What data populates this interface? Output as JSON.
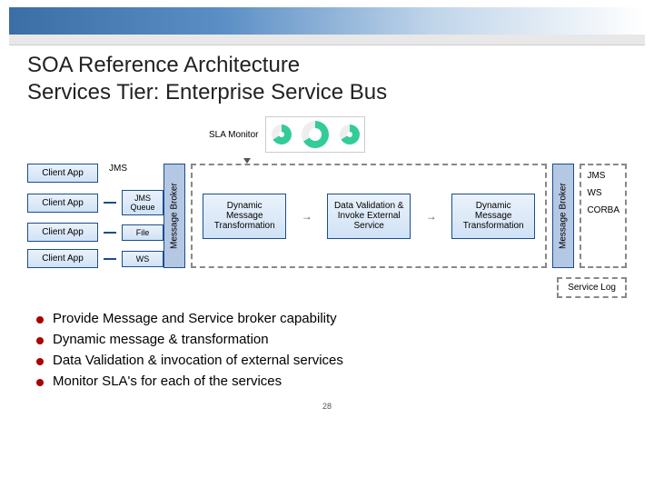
{
  "title_line1": "SOA Reference Architecture",
  "title_line2": "Services Tier: Enterprise Service Bus",
  "sla_label": "SLA Monitor",
  "clients": {
    "c1": "Client App",
    "c2": "Client App",
    "c3": "Client App",
    "c4": "Client App"
  },
  "adapters": {
    "jms_top": "JMS",
    "jms_queue": "JMS Queue",
    "file": "File",
    "ws": "WS"
  },
  "mb_label": "Message Broker",
  "stages": {
    "s1": "Dynamic Message Transformation",
    "s2": "Data Validation & Invoke External Service",
    "s3": "Dynamic Message Transformation"
  },
  "outputs": {
    "o1": "JMS",
    "o2": "WS",
    "o3": "CORBA"
  },
  "svc_log": "Service Log",
  "bullets": {
    "b1": "Provide Message and Service broker capability",
    "b2": "Dynamic message & transformation",
    "b3": "Data Validation & invocation of external services",
    "b4": "Monitor SLA's for each of the services"
  },
  "page_num": "28"
}
